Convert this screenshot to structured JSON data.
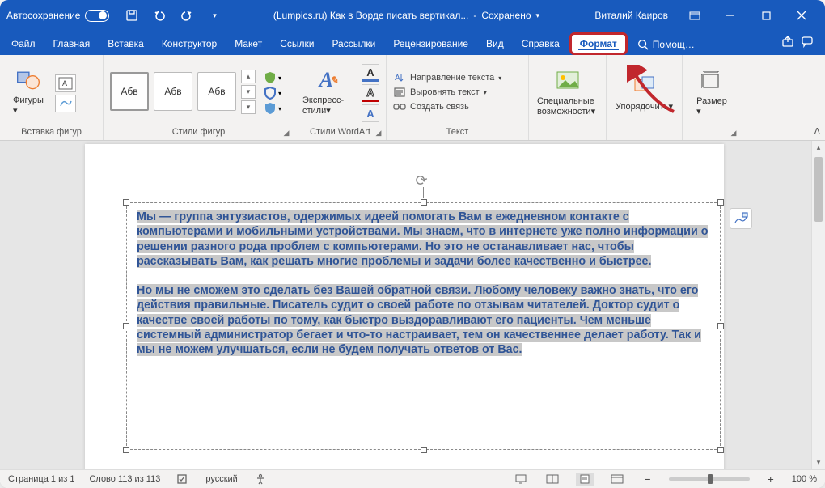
{
  "title": {
    "autosave": "Автосохранение",
    "doc": "(Lumpics.ru) Как в Ворде писать вертикал...",
    "saved": "Сохранено",
    "user": "Виталий Каиров"
  },
  "tabs": {
    "file": "Файл",
    "home": "Главная",
    "insert": "Вставка",
    "design": "Конструктор",
    "layout": "Макет",
    "refs": "Ссылки",
    "mail": "Рассылки",
    "review": "Рецензирование",
    "view": "Вид",
    "help": "Справка",
    "format": "Формат",
    "search_hint": "Помощ…"
  },
  "ribbon": {
    "shapes": "Фигуры",
    "insert_shapes": "Вставка фигур",
    "abc": "Абв",
    "shape_styles": "Стили фигур",
    "express": "Экспресс-стили",
    "wordart_styles": "Стили WordArt",
    "text_dir": "Направление текста",
    "align_text": "Выровнять текст",
    "link": "Создать связь",
    "text": "Текст",
    "access": "Специальные возможности",
    "arrange": "Упорядочить",
    "size": "Размер"
  },
  "body": {
    "p1": "Мы — группа энтузиастов, одержимых идеей помогать Вам в ежедневном контакте с компьютерами и мобильными устройствами. Мы знаем, что в интернете уже полно информации о решении разного рода проблем с компьютерами. Но это не останавливает нас, чтобы рассказывать Вам, как решать многие проблемы и задачи более качественно и быстрее.",
    "p2": "Но мы не сможем это сделать без Вашей обратной связи. Любому человеку важно знать, что его действия правильные. Писатель судит о своей работе по отзывам читателей. Доктор судит о качестве своей работы по тому, как быстро выздоравливают его пациенты. Чем меньше системный администратор бегает и что-то настраивает, тем он качественнее делает работу. Так и мы не можем улучшаться, если не будем получать ответов от Вас."
  },
  "status": {
    "page": "Страница 1 из 1",
    "words": "Слово 113 из 113",
    "lang": "русский",
    "zoom": "100 %"
  }
}
